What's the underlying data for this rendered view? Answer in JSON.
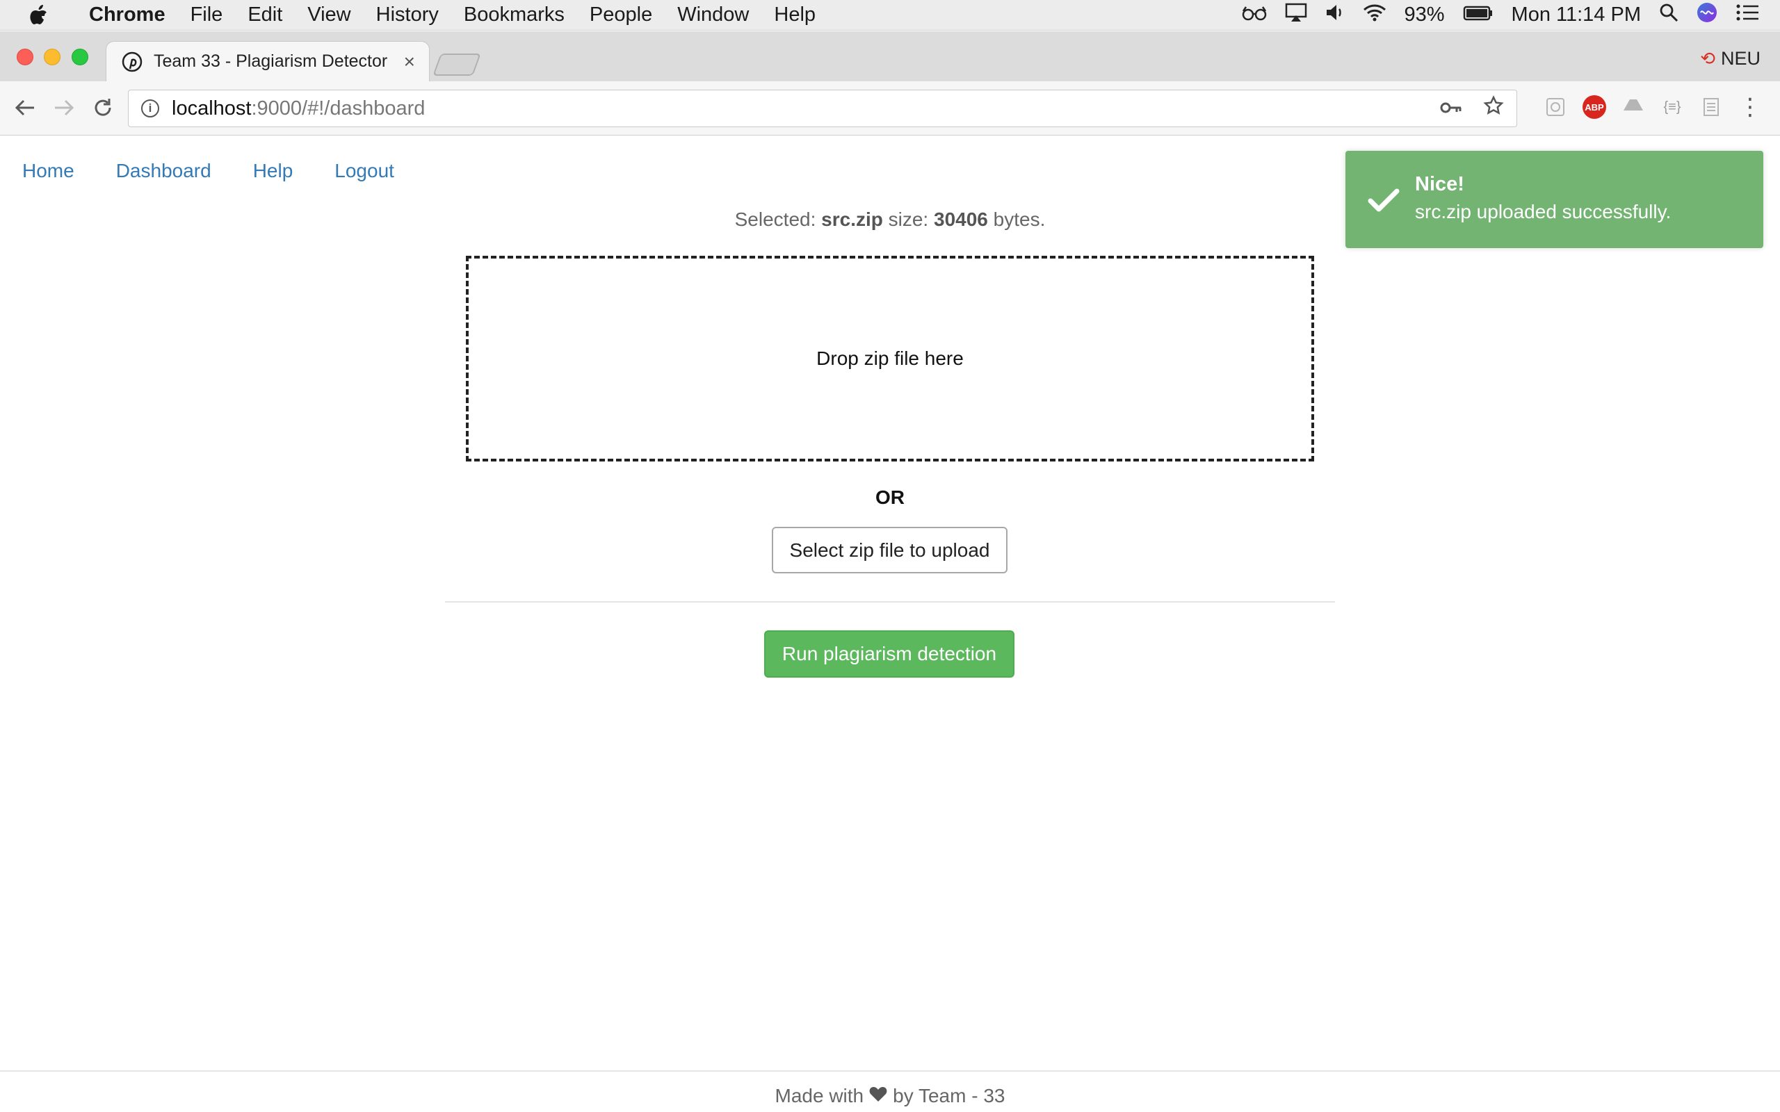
{
  "menubar": {
    "app": "Chrome",
    "items": [
      "File",
      "Edit",
      "View",
      "History",
      "Bookmarks",
      "People",
      "Window",
      "Help"
    ],
    "battery": "93%",
    "clock": "Mon 11:14 PM"
  },
  "browser": {
    "tab_title": "Team 33 - Plagiarism Detector",
    "profile": "NEU",
    "url_host": "localhost",
    "url_rest": ":9000/#!/dashboard"
  },
  "nav": {
    "items": [
      "Home",
      "Dashboard",
      "Help",
      "Logout"
    ]
  },
  "upload": {
    "selected_prefix": "Selected:",
    "filename": "src.zip",
    "size_label": "size:",
    "size_value": "30406",
    "size_suffix": "bytes.",
    "dropzone_text": "Drop zip file here",
    "or_text": "OR",
    "select_button": "Select zip file to upload",
    "run_button": "Run plagiarism detection"
  },
  "toast": {
    "title": "Nice!",
    "message": "src.zip uploaded successfully."
  },
  "footer": {
    "made_with": "Made with",
    "by": "by Team - 33"
  },
  "colors": {
    "link": "#337ab7",
    "success": "#5cb85c",
    "toast": "#74b472"
  }
}
